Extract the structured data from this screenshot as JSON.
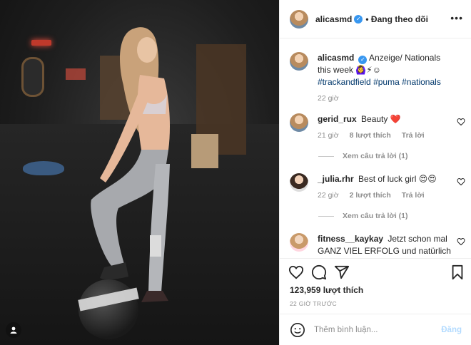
{
  "post": {
    "username": "alicasmd",
    "follow_status": "• Đang theo dõi",
    "caption_text": "Anzeige/ Nationals this week 🙆‍♀️⚡☺",
    "hashtags": [
      "#trackandfield",
      "#puma",
      "#nationals"
    ],
    "caption_time": "22 giờ"
  },
  "comments": [
    {
      "username": "gerid_rux",
      "text": "Beauty ❤️",
      "time": "21 giờ",
      "likes": "8 lượt thích",
      "reply": "Trả lời",
      "view_replies": "Xem câu trả lời (1)"
    },
    {
      "username": "_julia.rhr",
      "text": "Best of luck girl 😍😍",
      "time": "22 giờ",
      "likes": "2 lượt thích",
      "reply": "Trả lời",
      "view_replies": "Xem câu trả lời (1)"
    },
    {
      "username": "fitness__kaykay",
      "text": "Jetzt schon mal GANZ VIEL ERFOLG und natürlich"
    }
  ],
  "stats": {
    "likes": "123,959 lượt thích",
    "time_ago": "22 GIỜ TRƯỚC"
  },
  "composer": {
    "placeholder": "Thêm bình luận...",
    "post_label": "Đăng"
  },
  "colors": {
    "link": "#00376b",
    "verified": "#3897f0",
    "muted": "#8e8e8e",
    "post_disabled": "#b3dbff"
  },
  "icons": [
    "more-icon",
    "verified-icon",
    "heart-icon",
    "comment-icon",
    "share-icon",
    "bookmark-icon",
    "emoji-icon",
    "user-icon"
  ]
}
